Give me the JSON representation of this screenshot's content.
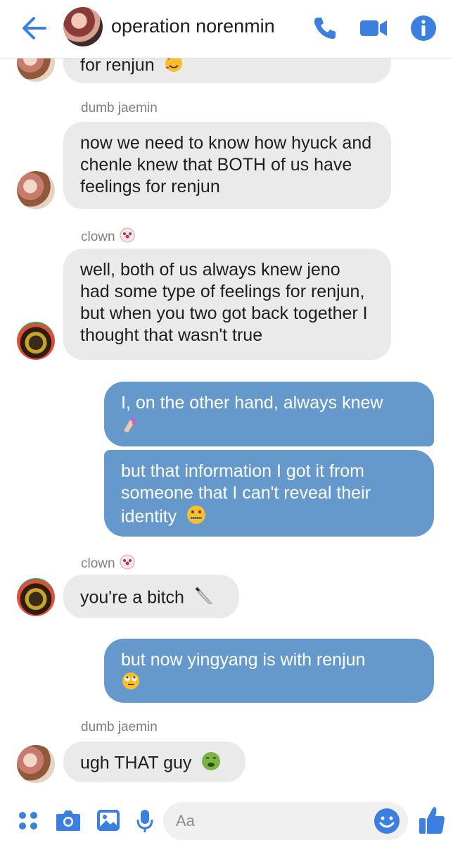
{
  "header": {
    "title": "operation norenmin",
    "back_icon": "arrow-left-icon",
    "call_icon": "phone-icon",
    "video_icon": "video-camera-icon",
    "info_icon": "info-icon",
    "accent_color": "#3b7fe0"
  },
  "messages": [
    {
      "id": "m0",
      "direction": "incoming",
      "sender": "",
      "text": "for renjun",
      "emoji": "smiling-face-with-hearts",
      "avatar": "jaemin"
    },
    {
      "id": "m1",
      "direction": "incoming",
      "sender": "dumb jaemin",
      "text": "now we need to know how hyuck and chenle knew that BOTH of us have feelings for renjun",
      "emoji": "",
      "avatar": "jaemin"
    },
    {
      "id": "m2",
      "direction": "incoming",
      "sender": "clown",
      "sender_emoji": "clown-face",
      "text": "well, both of us always knew jeno had some type of feelings for renjun, but when you two got back together I thought that wasn't true",
      "emoji": "",
      "avatar": "clown"
    },
    {
      "id": "m3",
      "direction": "outgoing",
      "sender": "",
      "text": "I, on the other hand, always knew",
      "emoji": "nail-polish"
    },
    {
      "id": "m4",
      "direction": "outgoing",
      "sender": "",
      "text": "but that information I got it from someone that I can't reveal their identity",
      "emoji": "zipper-mouth-face"
    },
    {
      "id": "m5",
      "direction": "incoming",
      "sender": "clown",
      "sender_emoji": "clown-face",
      "text": "you're a bitch",
      "emoji": "knife",
      "avatar": "clown"
    },
    {
      "id": "m6",
      "direction": "outgoing",
      "sender": "",
      "text": "but   now yingyang is with renjun",
      "emoji": "face-with-rolling-eyes"
    },
    {
      "id": "m7",
      "direction": "incoming",
      "sender": "dumb jaemin",
      "text": "ugh THAT guy",
      "emoji": "nauseated-face",
      "avatar": "jaemin"
    }
  ],
  "composer": {
    "placeholder": "Aa",
    "icons": [
      "apps-grid-icon",
      "camera-icon",
      "gallery-icon",
      "microphone-icon",
      "emoji-icon",
      "thumbs-up-icon"
    ]
  },
  "colors": {
    "outgoing_bubble": "#6599cc",
    "incoming_bubble": "#eaeaeb",
    "icon_blue": "#3b7fe0"
  }
}
